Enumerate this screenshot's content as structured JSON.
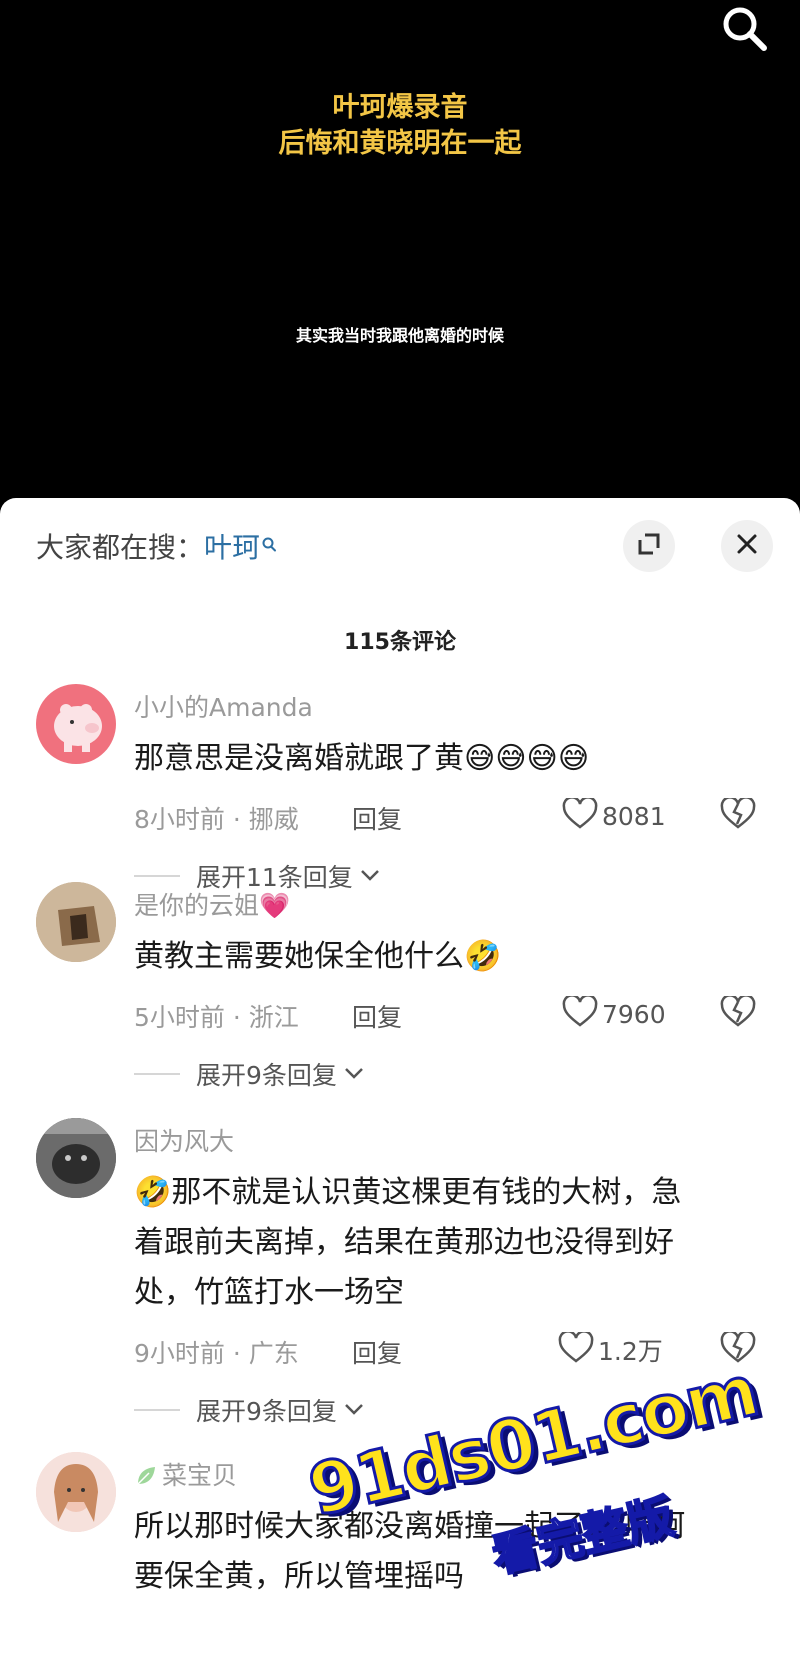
{
  "video": {
    "title_line1": "叶珂爆录音",
    "title_line2": "后悔和黄晓明在一起",
    "subtitle": "其实我当时我跟他离婚的时候"
  },
  "sheet": {
    "trending_label": "大家都在搜：",
    "trending_keyword": "叶珂",
    "comment_count": "115条评论"
  },
  "comments": [
    {
      "user": "小小的Amanda",
      "text": "那意思是没离婚就跟了黄",
      "emoji_suffix": "😅😅😅😅",
      "time_location": "8小时前 · 挪威",
      "reply_label": "回复",
      "likes": "8081",
      "expand_label": "展开11条回复"
    },
    {
      "user": "是你的云姐",
      "user_emoji": "💗",
      "text": "黄教主需要她保全他什么",
      "emoji_suffix": "🤣",
      "time_location": "5小时前 · 浙江",
      "reply_label": "回复",
      "likes": "7960",
      "expand_label": "展开9条回复"
    },
    {
      "user": "因为风大",
      "text_line1": "那不就是认识黄这棵更有钱的大树，急",
      "text_line2": "着跟前夫离掉，结果在黄那边也没得到好",
      "text_line3": "处，竹篮打水一场空",
      "emoji_prefix": "🤣",
      "time_location": "9小时前 · 广东",
      "reply_label": "回复",
      "likes": "1.2万",
      "expand_label": "展开9条回复"
    },
    {
      "user": "菜宝贝",
      "text_line1": "所以那时候大家都没离婚撞一起了?? 叶柯",
      "text_line2": "要保全黄，所以管埋摇吗"
    }
  ],
  "watermark": {
    "site": "91ds01.com",
    "tagline": "看完整版"
  },
  "colors": {
    "title_yellow": "#f3c646",
    "keyword_blue": "#2c6fa3",
    "meta_gray": "#9a9a9a"
  }
}
